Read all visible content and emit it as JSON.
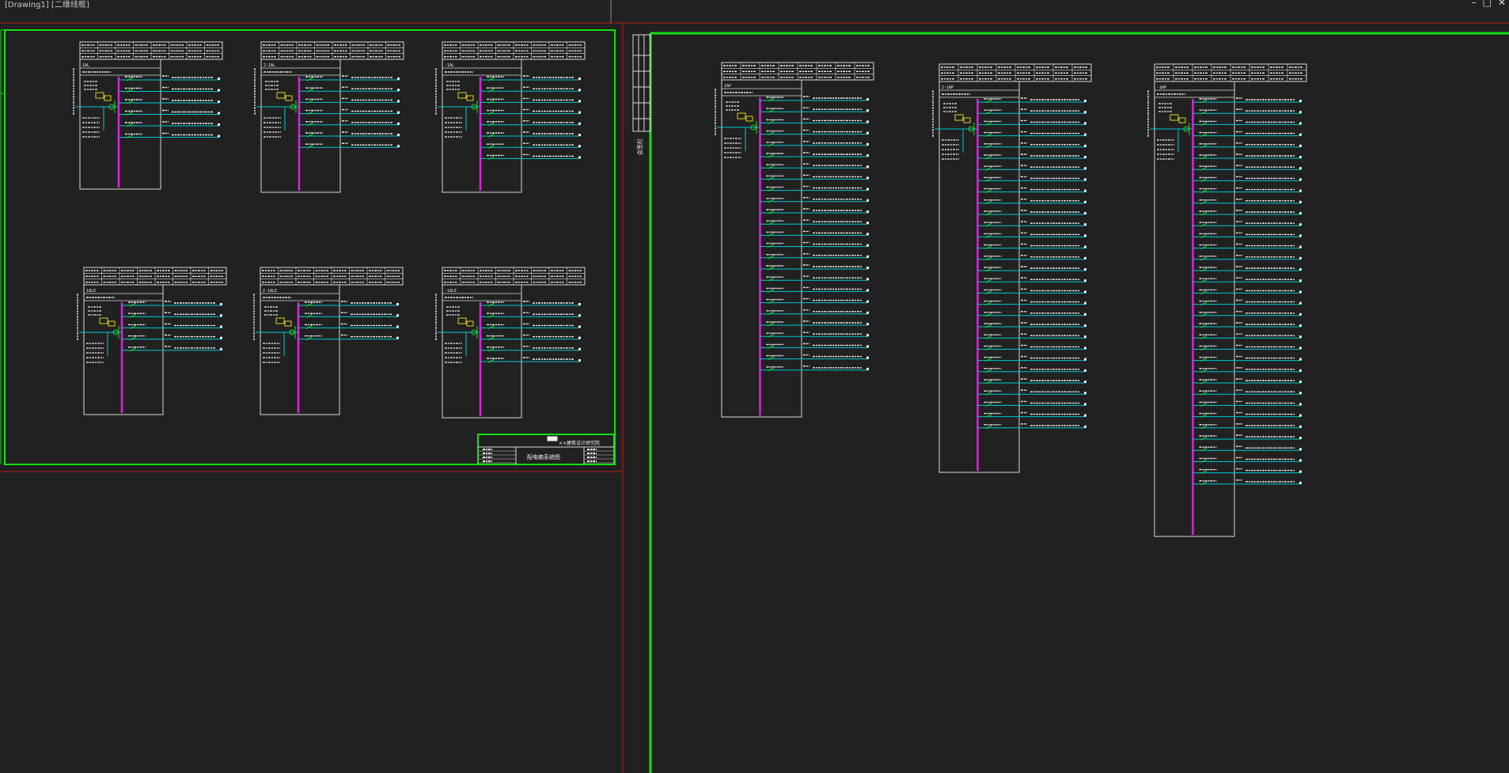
{
  "window": {
    "title": "[Drawing1] [二维线框]",
    "minimize_icon": "minimize-icon",
    "restore_icon": "restore-icon",
    "close_icon": "close-icon",
    "controls": [
      "–",
      "□",
      "✕"
    ]
  },
  "colors": {
    "background": "#212121",
    "frame_green": "#12e012",
    "frame_red": "#b81c1c",
    "box_white": "#d8d8d8",
    "busbar_magenta": "#e020e0",
    "feeder_cyan": "#00c8d8",
    "text_white": "#f0f0f0",
    "breaker_green": "#18e018",
    "meter_yellow": "#e0d020"
  },
  "sheet_left": {
    "title_block": {
      "company": "××建筑设计研究院",
      "drawing_title": "配电箱系统图"
    },
    "panels": [
      {
        "name": "1AL",
        "circuits": 6
      },
      {
        "name": "2-1AL",
        "circuits": 7
      },
      {
        "name": "-1AL",
        "circuits": 8
      },
      {
        "name": "1ALE",
        "circuits": 5
      },
      {
        "name": "2-1ALE",
        "circuits": 4
      },
      {
        "name": "-1ALE",
        "circuits": 6
      }
    ]
  },
  "sheet_right": {
    "side_label": "会签栏",
    "panels": [
      {
        "name": "1AP",
        "circuits": 25
      },
      {
        "name": "2-1AP",
        "circuits": 30
      },
      {
        "name": "-1AP",
        "circuits": 35
      }
    ]
  }
}
